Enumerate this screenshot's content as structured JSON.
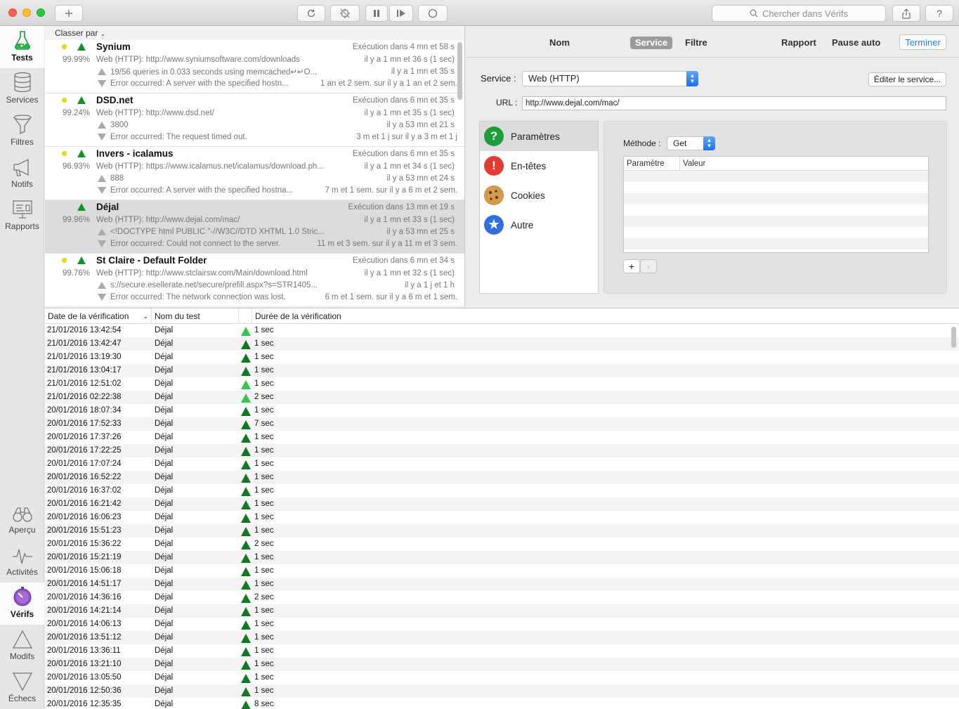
{
  "window": {
    "search_placeholder": "Chercher dans Vérifs"
  },
  "sidebar": {
    "top": [
      {
        "label": "Tests",
        "icon": "flask-icon",
        "active": true
      },
      {
        "label": "Services",
        "icon": "database-icon"
      },
      {
        "label": "Filtres",
        "icon": "funnel-icon"
      },
      {
        "label": "Notifs",
        "icon": "megaphone-icon"
      },
      {
        "label": "Rapports",
        "icon": "presentation-icon"
      }
    ],
    "bottom": [
      {
        "label": "Aperçu",
        "icon": "binoculars-icon"
      },
      {
        "label": "Activités",
        "icon": "pulse-icon"
      },
      {
        "label": "Vérifs",
        "icon": "stopwatch-icon",
        "active": true
      },
      {
        "label": "Modifs",
        "icon": "triangle-up-icon"
      },
      {
        "label": "Échecs",
        "icon": "triangle-down-icon"
      }
    ]
  },
  "testlist": {
    "sort_label": "Classer par",
    "tests": [
      {
        "name": "Synium",
        "pct": "99.99%",
        "schedule": "Exécution dans 4 mn et 58 s",
        "url": "Web (HTTP): http://www.syniumsoftware.com/downloads",
        "url_time": "il y a 1 mn et 36 s (1 sec)",
        "change": "19/56 queries in 0.033 seconds using memcached↵↵O...",
        "change_time": "il y a 1 mn et 35 s",
        "error": "Error occurred: A server with the specified hostn...",
        "error_time": "1 an et 2 sem. sur il y a 1 an et 2 sem."
      },
      {
        "name": "DSD.net",
        "pct": "99.24%",
        "schedule": "Exécution dans 6 mn et 35 s",
        "url": "Web (HTTP): http://www.dsd.net/",
        "url_time": "il y a 1 mn et 35 s (1 sec)",
        "change": "3800",
        "change_time": "il y a 53 mn et 21 s",
        "error": "Error occurred: The request timed out.",
        "error_time": "3 m et 1 j sur il y a 3 m et 1 j"
      },
      {
        "name": "Invers - icalamus",
        "pct": "96.93%",
        "schedule": "Exécution dans 6 mn et 35 s",
        "url": "Web (HTTP): https://www.icalamus.net/icalamus/download.ph...",
        "url_time": "il y a 1 mn et 34 s (1 sec)",
        "change": "888",
        "change_time": "il y a 53 mn et 24 s",
        "error": "Error occurred: A server with the specified hostna...",
        "error_time": "7 m et 1 sem. sur il y a 6 m et 2 sem."
      },
      {
        "name": "Déjal",
        "pct": "99.96%",
        "schedule": "Exécution dans 13 mn et 19 s",
        "url": "Web (HTTP): http://www.dejal.com/mac/",
        "url_time": "il y a 1 mn et 33 s (1 sec)",
        "change": "<!DOCTYPE html PUBLIC \"-//W3C//DTD XHTML 1.0 Stric...",
        "change_time": "il y a 53 mn et 25 s",
        "error": "Error occurred: Could not connect to the server.",
        "error_time": "11 m et 3 sem. sur il y a 11 m et 3 sem."
      },
      {
        "name": "St Claire - Default Folder",
        "pct": "99.76%",
        "schedule": "Exécution dans 6 mn et 34 s",
        "url": "Web (HTTP): http://www.stclairsw.com/Main/download.html",
        "url_time": "il y a 1 mn et 32 s (1 sec)",
        "change": "s://secure.esellerate.net/secure/prefill.aspx?s=STR1405...",
        "change_time": "il y a 1 j et 1 h",
        "error": "Error occurred: The network connection was lost.",
        "error_time": "6 m et 1 sem. sur il y a 6 m et 1 sem."
      }
    ]
  },
  "detail": {
    "tabs": {
      "nom": "Nom",
      "service": "Service",
      "filtre": "Filtre",
      "rapport": "Rapport",
      "pause": "Pause auto",
      "done": "Terminer"
    },
    "service_label": "Service :",
    "service_value": "Web (HTTP)",
    "edit_service": "Éditer le service...",
    "url_label": "URL :",
    "url_value": "http://www.dejal.com/mac/",
    "categories": [
      {
        "label": "Paramètres",
        "icon": "question-icon"
      },
      {
        "label": "En-têtes",
        "icon": "alert-icon"
      },
      {
        "label": "Cookies",
        "icon": "cookie-icon"
      },
      {
        "label": "Autre",
        "icon": "star-icon"
      }
    ],
    "method_label": "Méthode :",
    "method_value": "Get",
    "table_headers": {
      "param": "Paramètre",
      "value": "Valeur"
    },
    "add": "+",
    "remove": "-"
  },
  "verifs": {
    "headers": {
      "date": "Date de la vérification",
      "name": "Nom du test",
      "duration": "Durée de la vérification"
    },
    "rows": [
      {
        "date": "21/01/2016 13:42:54",
        "name": "Déjal",
        "dur": "1 sec",
        "light": true
      },
      {
        "date": "21/01/2016 13:42:47",
        "name": "Déjal",
        "dur": "1 sec",
        "light": false
      },
      {
        "date": "21/01/2016 13:19:30",
        "name": "Déjal",
        "dur": "1 sec",
        "light": false
      },
      {
        "date": "21/01/2016 13:04:17",
        "name": "Déjal",
        "dur": "1 sec",
        "light": false
      },
      {
        "date": "21/01/2016 12:51:02",
        "name": "Déjal",
        "dur": "1 sec",
        "light": true
      },
      {
        "date": "21/01/2016 02:22:38",
        "name": "Déjal",
        "dur": "2 sec",
        "light": true
      },
      {
        "date": "20/01/2016 18:07:34",
        "name": "Déjal",
        "dur": "1 sec",
        "light": false
      },
      {
        "date": "20/01/2016 17:52:33",
        "name": "Déjal",
        "dur": "7 sec",
        "light": false
      },
      {
        "date": "20/01/2016 17:37:26",
        "name": "Déjal",
        "dur": "1 sec",
        "light": false
      },
      {
        "date": "20/01/2016 17:22:25",
        "name": "Déjal",
        "dur": "1 sec",
        "light": false
      },
      {
        "date": "20/01/2016 17:07:24",
        "name": "Déjal",
        "dur": "1 sec",
        "light": false
      },
      {
        "date": "20/01/2016 16:52:22",
        "name": "Déjal",
        "dur": "1 sec",
        "light": false
      },
      {
        "date": "20/01/2016 16:37:02",
        "name": "Déjal",
        "dur": "1 sec",
        "light": false
      },
      {
        "date": "20/01/2016 16:21:42",
        "name": "Déjal",
        "dur": "1 sec",
        "light": false
      },
      {
        "date": "20/01/2016 16:06:23",
        "name": "Déjal",
        "dur": "1 sec",
        "light": false
      },
      {
        "date": "20/01/2016 15:51:23",
        "name": "Déjal",
        "dur": "1 sec",
        "light": false
      },
      {
        "date": "20/01/2016 15:36:22",
        "name": "Déjal",
        "dur": "2 sec",
        "light": false
      },
      {
        "date": "20/01/2016 15:21:19",
        "name": "Déjal",
        "dur": "1 sec",
        "light": false
      },
      {
        "date": "20/01/2016 15:06:18",
        "name": "Déjal",
        "dur": "1 sec",
        "light": false
      },
      {
        "date": "20/01/2016 14:51:17",
        "name": "Déjal",
        "dur": "1 sec",
        "light": false
      },
      {
        "date": "20/01/2016 14:36:16",
        "name": "Déjal",
        "dur": "2 sec",
        "light": false
      },
      {
        "date": "20/01/2016 14:21:14",
        "name": "Déjal",
        "dur": "1 sec",
        "light": false
      },
      {
        "date": "20/01/2016 14:06:13",
        "name": "Déjal",
        "dur": "1 sec",
        "light": false
      },
      {
        "date": "20/01/2016 13:51:12",
        "name": "Déjal",
        "dur": "1 sec",
        "light": false
      },
      {
        "date": "20/01/2016 13:36:11",
        "name": "Déjal",
        "dur": "1 sec",
        "light": false
      },
      {
        "date": "20/01/2016 13:21:10",
        "name": "Déjal",
        "dur": "1 sec",
        "light": false
      },
      {
        "date": "20/01/2016 13:05:50",
        "name": "Déjal",
        "dur": "1 sec",
        "light": false
      },
      {
        "date": "20/01/2016 12:50:36",
        "name": "Déjal",
        "dur": "1 sec",
        "light": false
      },
      {
        "date": "20/01/2016 12:35:35",
        "name": "Déjal",
        "dur": "8 sec",
        "light": false
      }
    ]
  }
}
